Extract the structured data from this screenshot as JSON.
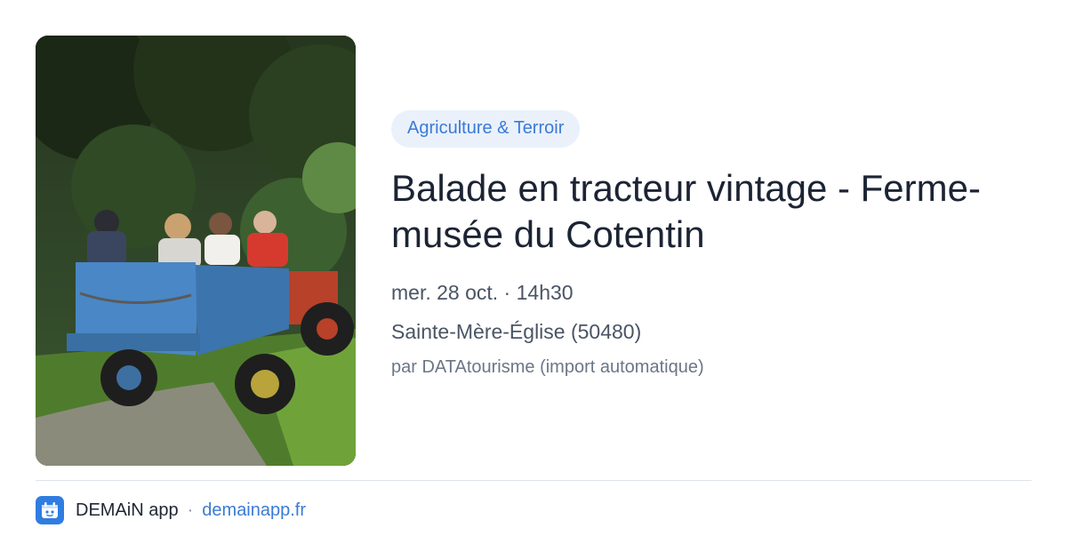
{
  "event": {
    "category": "Agriculture & Terroir",
    "title": "Balade en tracteur vintage - Ferme-musée du Cotentin",
    "date_time": "mer. 28 oct. · 14h30",
    "location": "Sainte-Mère-Église (50480)",
    "source": "par DATAtourisme (import automatique)",
    "image_icon": "tractor-wagon-ride-photo"
  },
  "footer": {
    "app_name": "DEMAiN app",
    "separator": "·",
    "domain": "demainapp.fr",
    "logo_icon": "demain-app-logo-icon"
  },
  "colors": {
    "accent": "#3a7bd5",
    "badge_bg": "#eaf1fb",
    "logo_bg": "#2f7de1",
    "title": "#1c2434",
    "meta": "#4a5565"
  }
}
